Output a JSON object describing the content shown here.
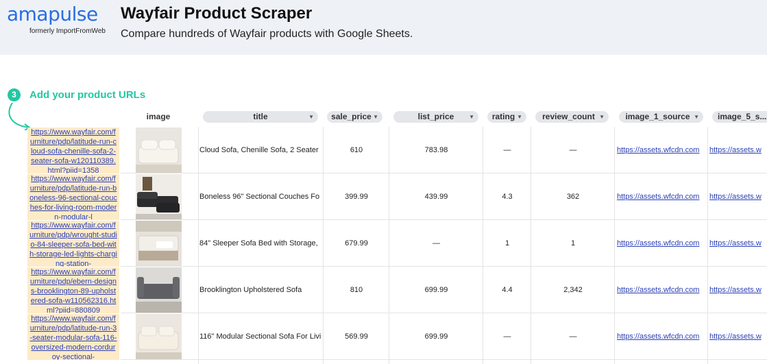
{
  "header": {
    "logo": "amapulse",
    "logo_sub": "formerly ImportFromWeb",
    "title": "Wayfair Product Scraper",
    "subtitle": "Compare hundreds of Wayfair products with Google Sheets."
  },
  "step": {
    "number": "3",
    "label": "Add your product URLs"
  },
  "columns": {
    "image": "image",
    "title": "title",
    "sale_price": "sale_price",
    "list_price": "list_price",
    "rating": "rating",
    "review_count": "review_count",
    "image_1_source": "image_1_source",
    "image_5_source": "image_5_s..."
  },
  "rows": [
    {
      "url": "https://www.wayfair.com/furniture/pdp/latitude-run-cloud-sofa-chenille-sofa-2-seater-sofa-w120110389.html?piid=1358",
      "title": "Cloud Sofa, Chenille Sofa, 2 Seater",
      "sale_price": "610",
      "list_price": "783.98",
      "rating": "—",
      "review_count": "—",
      "image_1_source": "https://assets.wfcdn.com",
      "image_5_source": "https://assets.w"
    },
    {
      "url": "https://www.wayfair.com/furniture/pdp/latitude-run-boneless-96-sectional-couches-for-living-room-modern-modular-l",
      "title": "Boneless 96\" Sectional Couches Fo",
      "sale_price": "399.99",
      "list_price": "439.99",
      "rating": "4.3",
      "review_count": "362",
      "image_1_source": "https://assets.wfcdn.com",
      "image_5_source": "https://assets.w"
    },
    {
      "url": "https://www.wayfair.com/furniture/pdp/wrought-studio-84-sleeper-sofa-bed-with-storage-led-lights-charging-station-",
      "title": "84\" Sleeper Sofa Bed with Storage,",
      "sale_price": "679.99",
      "list_price": "—",
      "rating": "1",
      "review_count": "1",
      "image_1_source": "https://assets.wfcdn.com",
      "image_5_source": "https://assets.w"
    },
    {
      "url": "https://www.wayfair.com/furniture/pdp/ebern-designs-brooklington-89-upholstered-sofa-w110562316.html?piid=880809",
      "title": "Brooklington Upholstered Sofa",
      "sale_price": "810",
      "list_price": "699.99",
      "rating": "4.4",
      "review_count": "2,342",
      "image_1_source": "https://assets.wfcdn.com",
      "image_5_source": "https://assets.w"
    },
    {
      "url": "https://www.wayfair.com/furniture/pdp/latitude-run-3-seater-modular-sofa-116-oversized-modern-corduroy-sectional-",
      "title": "116\" Modular Sectional Sofa For Livi",
      "sale_price": "569.99",
      "list_price": "699.99",
      "rating": "—",
      "review_count": "—",
      "image_1_source": "https://assets.wfcdn.com",
      "image_5_source": "https://assets.w"
    }
  ]
}
